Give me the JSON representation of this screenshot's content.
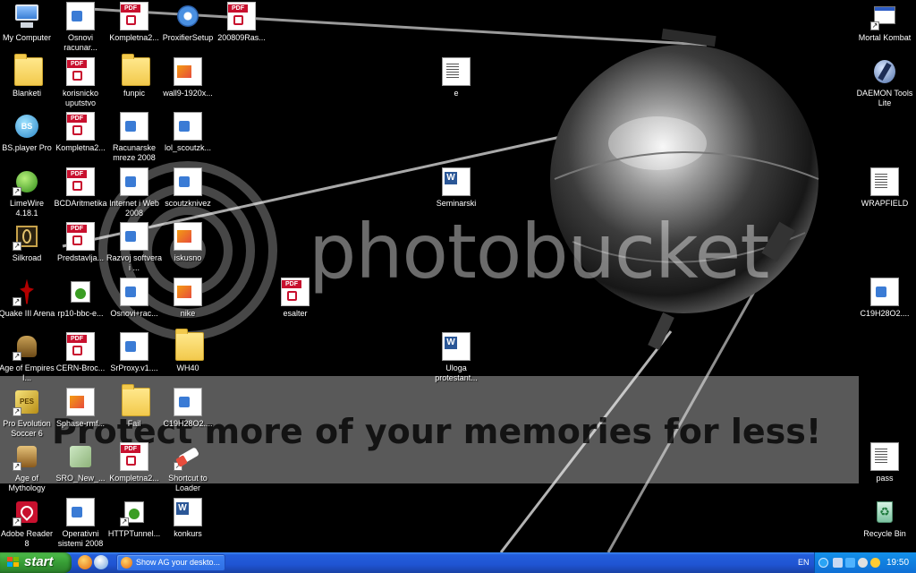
{
  "desktop": {
    "watermark": {
      "brand": "photobucket",
      "tagline": "Protect more of your memories for less!"
    },
    "icons": [
      {
        "id": "my-computer",
        "label": "My Computer",
        "icon": "computer-icon",
        "col": 0,
        "row": 0
      },
      {
        "id": "blanketi",
        "label": "Blanketi",
        "icon": "folder-icon",
        "col": 0,
        "row": 1
      },
      {
        "id": "bsplayer",
        "label": "BS.player Pro",
        "icon": "bsplayer-icon",
        "col": 0,
        "row": 2
      },
      {
        "id": "limewire",
        "label": "LimeWire 4.18.1",
        "icon": "limewire-icon",
        "col": 0,
        "row": 3,
        "shortcut": true
      },
      {
        "id": "silkroad",
        "label": "Silkroad",
        "icon": "silkroad-icon",
        "col": 0,
        "row": 4,
        "shortcut": true
      },
      {
        "id": "quake",
        "label": "Quake III Arena",
        "icon": "quake-icon",
        "col": 0,
        "row": 5,
        "shortcut": true
      },
      {
        "id": "aoe",
        "label": "Age of Empires I...",
        "icon": "aoe-icon",
        "col": 0,
        "row": 6,
        "shortcut": true
      },
      {
        "id": "pes6",
        "label": "Pro Evolution Soccer 6",
        "icon": "pes-icon",
        "col": 0,
        "row": 7,
        "shortcut": true
      },
      {
        "id": "aom",
        "label": "Age of Mythology",
        "icon": "aom-icon",
        "col": 0,
        "row": 8,
        "shortcut": true
      },
      {
        "id": "adobe",
        "label": "Adobe Reader 8",
        "icon": "adobe-reader-icon",
        "col": 0,
        "row": 9,
        "shortcut": true
      },
      {
        "id": "osnovi-racunar",
        "label": "Osnovi racunar...",
        "icon": "script-icon",
        "col": 1,
        "row": 0
      },
      {
        "id": "korisnicko",
        "label": "korisnicko uputstvo",
        "icon": "pdf-icon",
        "col": 1,
        "row": 1
      },
      {
        "id": "kompletna2-a",
        "label": "Kompletna2...",
        "icon": "pdf-icon",
        "col": 1,
        "row": 2
      },
      {
        "id": "bcd",
        "label": "BCDAritmetika",
        "icon": "pdf-icon",
        "col": 1,
        "row": 3
      },
      {
        "id": "predstavlja",
        "label": "Predstavlja...",
        "icon": "pdf-icon",
        "col": 1,
        "row": 4
      },
      {
        "id": "rp10",
        "label": "rp10-bbc-e...",
        "icon": "http-icon",
        "col": 1,
        "row": 5
      },
      {
        "id": "cern",
        "label": "CERN-Broc...",
        "icon": "pdf-icon",
        "col": 1,
        "row": 6
      },
      {
        "id": "sphase",
        "label": "Sphase-rmf...",
        "icon": "image-file-icon",
        "col": 1,
        "row": 7
      },
      {
        "id": "sro-new",
        "label": "SRO_New_...",
        "icon": "sro-icon",
        "col": 1,
        "row": 8
      },
      {
        "id": "operativni",
        "label": "Operativni sistemi 2008",
        "icon": "script-icon",
        "col": 1,
        "row": 9
      },
      {
        "id": "kompletna2-b",
        "label": "Kompletna2...",
        "icon": "pdf-icon",
        "col": 2,
        "row": 0
      },
      {
        "id": "funpic",
        "label": "funpic",
        "icon": "folder-icon",
        "col": 2,
        "row": 1
      },
      {
        "id": "racunarske",
        "label": "Racunarske mreze 2008",
        "icon": "script-icon",
        "col": 2,
        "row": 2
      },
      {
        "id": "internet-web",
        "label": "Internet i Web 2008",
        "icon": "script-icon",
        "col": 2,
        "row": 3
      },
      {
        "id": "razvoj",
        "label": "Razvoj softvera i ...",
        "icon": "script-icon",
        "col": 2,
        "row": 4
      },
      {
        "id": "osnovi-rac",
        "label": "Osnovi+rac...",
        "icon": "script-icon",
        "col": 2,
        "row": 5
      },
      {
        "id": "srproxy",
        "label": "SrProxy.v1....",
        "icon": "script-icon",
        "col": 2,
        "row": 6
      },
      {
        "id": "fail",
        "label": "Fail",
        "icon": "folder-icon",
        "col": 2,
        "row": 7
      },
      {
        "id": "kompletna2-c",
        "label": "Kompletna2...",
        "icon": "pdf-icon",
        "col": 2,
        "row": 8
      },
      {
        "id": "httptunnel",
        "label": "HTTPTunnel...",
        "icon": "httptunnel-icon",
        "col": 2,
        "row": 9,
        "shortcut": true
      },
      {
        "id": "proxifier",
        "label": "ProxifierSetup",
        "icon": "setup-icon",
        "col": 3,
        "row": 0
      },
      {
        "id": "wall9",
        "label": "wall9-1920x...",
        "icon": "image-file-icon",
        "col": 3,
        "row": 1
      },
      {
        "id": "lol-scout",
        "label": "lol_scoutzk...",
        "icon": "script-icon",
        "col": 3,
        "row": 2
      },
      {
        "id": "scoutzknivez",
        "label": "scoutzknivez",
        "icon": "script-icon",
        "col": 3,
        "row": 3
      },
      {
        "id": "iskusno",
        "label": "iskusno",
        "icon": "image-file-icon",
        "col": 3,
        "row": 4
      },
      {
        "id": "nike",
        "label": "nike",
        "icon": "image-file-icon",
        "col": 3,
        "row": 5
      },
      {
        "id": "wh40",
        "label": "WH40",
        "icon": "folder-icon",
        "col": 3,
        "row": 6
      },
      {
        "id": "c19h28o2-a",
        "label": "C19H28O2....",
        "icon": "script-icon",
        "col": 3,
        "row": 7
      },
      {
        "id": "shortcut-loader",
        "label": "Shortcut to Loader",
        "icon": "loader-icon",
        "col": 3,
        "row": 8,
        "shortcut": true
      },
      {
        "id": "konkurs",
        "label": "konkurs",
        "icon": "word-doc-icon",
        "col": 3,
        "row": 9
      },
      {
        "id": "200809ras",
        "label": "200809Ras...",
        "icon": "pdf-icon",
        "col": 4,
        "row": 0
      },
      {
        "id": "esalter",
        "label": "esalter",
        "icon": "pdf-icon",
        "col": 5,
        "row": 5
      },
      {
        "id": "e",
        "label": "e",
        "icon": "text-doc-icon",
        "col": 8,
        "row": 1
      },
      {
        "id": "seminarski",
        "label": "Seminarski",
        "icon": "word-doc-icon",
        "col": 8,
        "row": 3
      },
      {
        "id": "uloga",
        "label": "Uloga protestant...",
        "icon": "word-doc-icon",
        "col": 8,
        "row": 6
      },
      {
        "id": "mortal-kombat",
        "label": "Mortal Kombat",
        "icon": "window-icon",
        "col": 16,
        "row": 0,
        "shortcut": true
      },
      {
        "id": "daemon",
        "label": "DAEMON Tools Lite",
        "icon": "daemon-tools-icon",
        "col": 16,
        "row": 1
      },
      {
        "id": "wrapfield",
        "label": "WRAPFIELD",
        "icon": "text-doc-icon",
        "col": 16,
        "row": 3
      },
      {
        "id": "c19h28o2-b",
        "label": "C19H28O2....",
        "icon": "script-icon",
        "col": 16,
        "row": 5
      },
      {
        "id": "pass",
        "label": "pass",
        "icon": "text-doc-icon",
        "col": 16,
        "row": 8
      },
      {
        "id": "recycle",
        "label": "Recycle Bin",
        "icon": "recycle-bin-icon",
        "col": 16,
        "row": 9
      }
    ]
  },
  "taskbar": {
    "start_label": "start",
    "task_label": "Show AG your deskto...",
    "language": "EN",
    "clock": "19:50"
  },
  "colors": {
    "taskbar_blue": "#245edb",
    "start_green": "#379d35",
    "tray_blue": "#0f6fd5"
  }
}
